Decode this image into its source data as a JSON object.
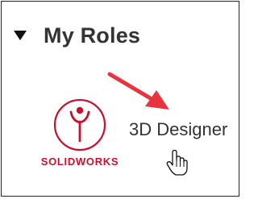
{
  "section": {
    "title": "My Roles",
    "collapse_icon": "triangle-down-icon"
  },
  "role": {
    "label": "3D Designer",
    "logo_text": "SOLIDWORKS",
    "logo_icon": "solidworks-logo-icon",
    "brand_color": "#c8102e"
  },
  "annotation": {
    "arrow_icon": "red-arrow-icon",
    "arrow_color": "#e8343c",
    "cursor_icon": "hand-pointer-icon"
  }
}
